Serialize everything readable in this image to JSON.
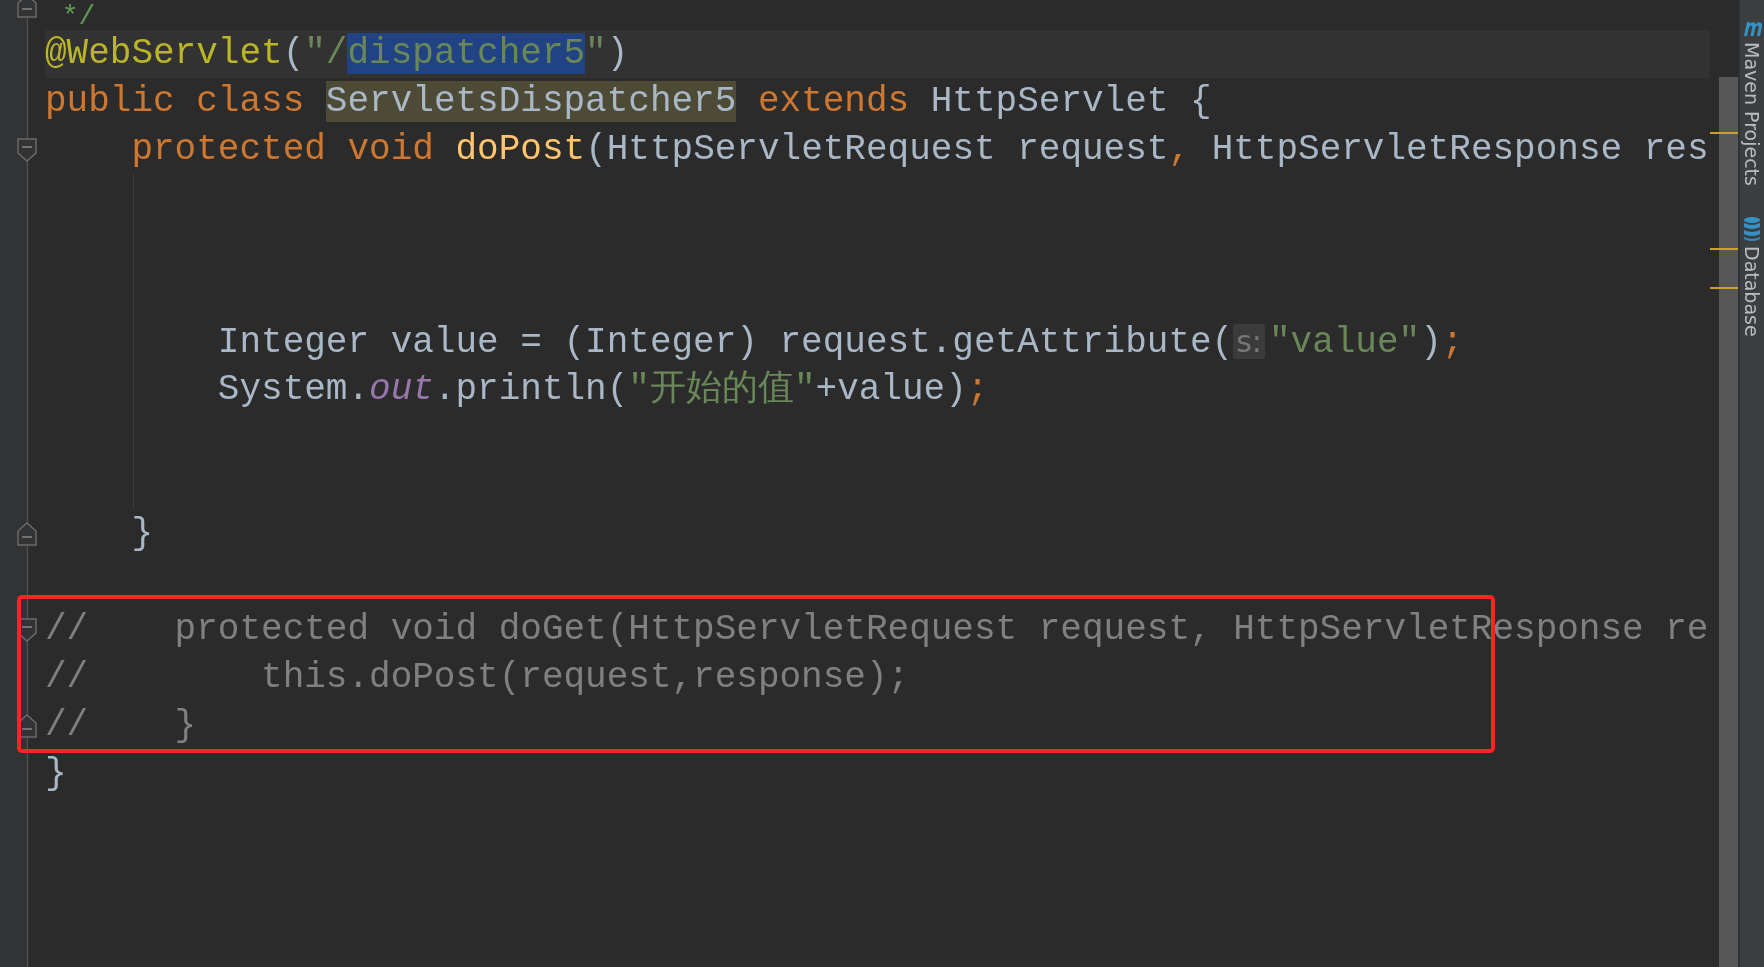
{
  "editor": {
    "lines": [
      {
        "gutter_icon": {
          "kind": "fold-end"
        },
        "indent_guide": false,
        "tokens": [
          {
            "text": " */",
            "kind": "doc-comment"
          }
        ]
      },
      {
        "caret": true,
        "indent_guide": false,
        "tokens": [
          {
            "text": "@WebServlet",
            "kind": "annotation"
          },
          {
            "text": "(",
            "kind": "plain"
          },
          {
            "text": "\"/",
            "kind": "string"
          },
          {
            "text": "dispatcher5",
            "kind": "string",
            "selected": true
          },
          {
            "text": "\"",
            "kind": "string"
          },
          {
            "text": ")",
            "kind": "plain"
          }
        ]
      },
      {
        "indent_guide": false,
        "tokens": [
          {
            "text": "public",
            "kind": "keyword"
          },
          {
            "text": " class ",
            "kind": "keyword"
          },
          {
            "text": "ServletsDispatcher5",
            "kind": "plain",
            "highlighted": true
          },
          {
            "text": " extends",
            "kind": "keyword"
          },
          {
            "text": " HttpServlet {",
            "kind": "plain"
          }
        ]
      },
      {
        "gutter_icon": {
          "kind": "fold-start"
        },
        "indent_guide": false,
        "tokens": [
          {
            "text": "    protected",
            "kind": "keyword"
          },
          {
            "text": " void",
            "kind": "keyword"
          },
          {
            "text": " doPost",
            "kind": "method"
          },
          {
            "text": "(HttpServletRequest request",
            "kind": "plain"
          },
          {
            "text": ",",
            "kind": "keyword"
          },
          {
            "text": " HttpServletResponse res",
            "kind": "plain"
          }
        ]
      },
      {
        "indent_guide": true
      },
      {
        "indent_guide": true
      },
      {
        "indent_guide": true
      },
      {
        "indent_guide": true,
        "tokens": [
          {
            "text": "        Integer value = (Integer) request.getAttribute(",
            "kind": "plain"
          },
          {
            "text": "s:",
            "kind": "hint"
          },
          {
            "text": "\"value\"",
            "kind": "string"
          },
          {
            "text": ")",
            "kind": "plain"
          },
          {
            "text": ";",
            "kind": "keyword"
          }
        ]
      },
      {
        "indent_guide": true,
        "tokens": [
          {
            "text": "        System.",
            "kind": "plain"
          },
          {
            "text": "out",
            "kind": "field"
          },
          {
            "text": ".println(",
            "kind": "plain"
          },
          {
            "text": "\"开始的值\"",
            "kind": "string"
          },
          {
            "text": "+value)",
            "kind": "plain"
          },
          {
            "text": ";",
            "kind": "keyword"
          }
        ]
      },
      {
        "indent_guide": true
      },
      {
        "indent_guide": true
      },
      {
        "gutter_icon": {
          "kind": "fold-end"
        },
        "indent_guide": false,
        "tokens": [
          {
            "text": "    }",
            "kind": "plain"
          }
        ]
      },
      {
        "indent_guide": false
      },
      {
        "gutter_icon": {
          "kind": "fold-start"
        },
        "boxed": true,
        "indent_guide": false,
        "tokens": [
          {
            "text": "//    protected void doGet(HttpServletRequest request, HttpServletResponse re",
            "kind": "comment"
          }
        ]
      },
      {
        "boxed": true,
        "indent_guide": false,
        "tokens": [
          {
            "text": "//        this.doPost(request,response);",
            "kind": "comment"
          }
        ]
      },
      {
        "gutter_icon": {
          "kind": "fold-end"
        },
        "boxed": true,
        "indent_guide": false,
        "tokens": [
          {
            "text": "//    }",
            "kind": "comment"
          }
        ]
      },
      {
        "indent_guide": false,
        "tokens": [
          {
            "text": "}",
            "kind": "plain"
          }
        ]
      }
    ]
  },
  "tool_strip": [
    {
      "label": "Maven Projects",
      "kind": "maven"
    },
    {
      "label": "Database",
      "kind": "database"
    }
  ]
}
